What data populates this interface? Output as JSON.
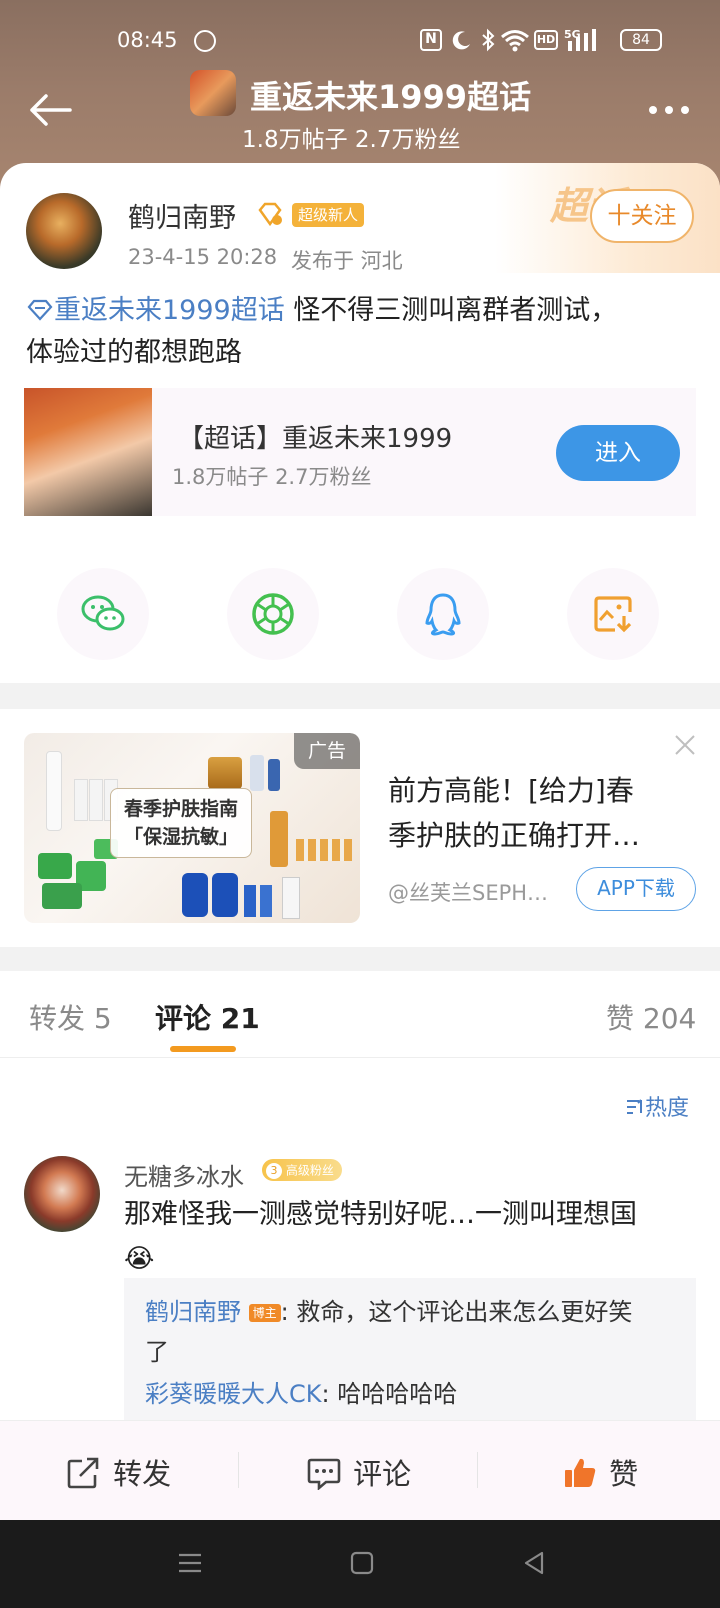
{
  "status_bar": {
    "time": "08:45",
    "battery": "84"
  },
  "header": {
    "title": "重返未来1999超话",
    "subtitle": "1.8万帖子 2.7万粉丝"
  },
  "post": {
    "author": "鹤归南野",
    "author_badge": "超级新人",
    "time": "23-4-15 20:28",
    "location": "发布于 河北",
    "follow_label": "十关注",
    "topic_link": "重返未来1999超话",
    "text_line1": " 怪不得三测叫离群者测试，",
    "text_line2": "体验过的都想跑路",
    "topic_card": {
      "title": "【超话】重返未来1999",
      "stats": "1.8万帖子 2.7万粉丝",
      "enter_label": "进入"
    },
    "watermark": "超话"
  },
  "share": [
    {
      "icon": "wechat-icon",
      "color": "#3bbf6a"
    },
    {
      "icon": "moments-icon",
      "color": "#44c04f"
    },
    {
      "icon": "qq-icon",
      "color": "#3a9df0"
    },
    {
      "icon": "save-image-icon",
      "color": "#f0a030"
    }
  ],
  "ad": {
    "tag": "广告",
    "image_text_line1": "春季护肤指南",
    "image_text_line2": "「保湿抗敏」",
    "title_line1": "前方高能！[给力]春",
    "title_line2": "季护肤的正确打开…",
    "source": "@丝芙兰SEPH…",
    "cta": "APP下载"
  },
  "tabs": {
    "repost": "转发 5",
    "comments": "评论 21",
    "likes": "赞 204",
    "accent": "#f39a1f"
  },
  "sort_label": "热度",
  "comment": {
    "user": "无糖多冰水",
    "fan_badge": "高级粉丝",
    "fan_level": "3",
    "text": "那难怪我一测感觉特别好呢…一测叫理想国",
    "emoji": "😭",
    "replies": [
      {
        "user": "鹤归南野",
        "badge": "博主",
        "text": ": 救命，这个评论出来怎么更好笑",
        "text2": "了"
      },
      {
        "user": "彩葵暖暖大人CK",
        "text": ": 哈哈哈哈哈"
      }
    ]
  },
  "actions": {
    "repost": "转发",
    "comment": "评论",
    "like": "赞"
  }
}
